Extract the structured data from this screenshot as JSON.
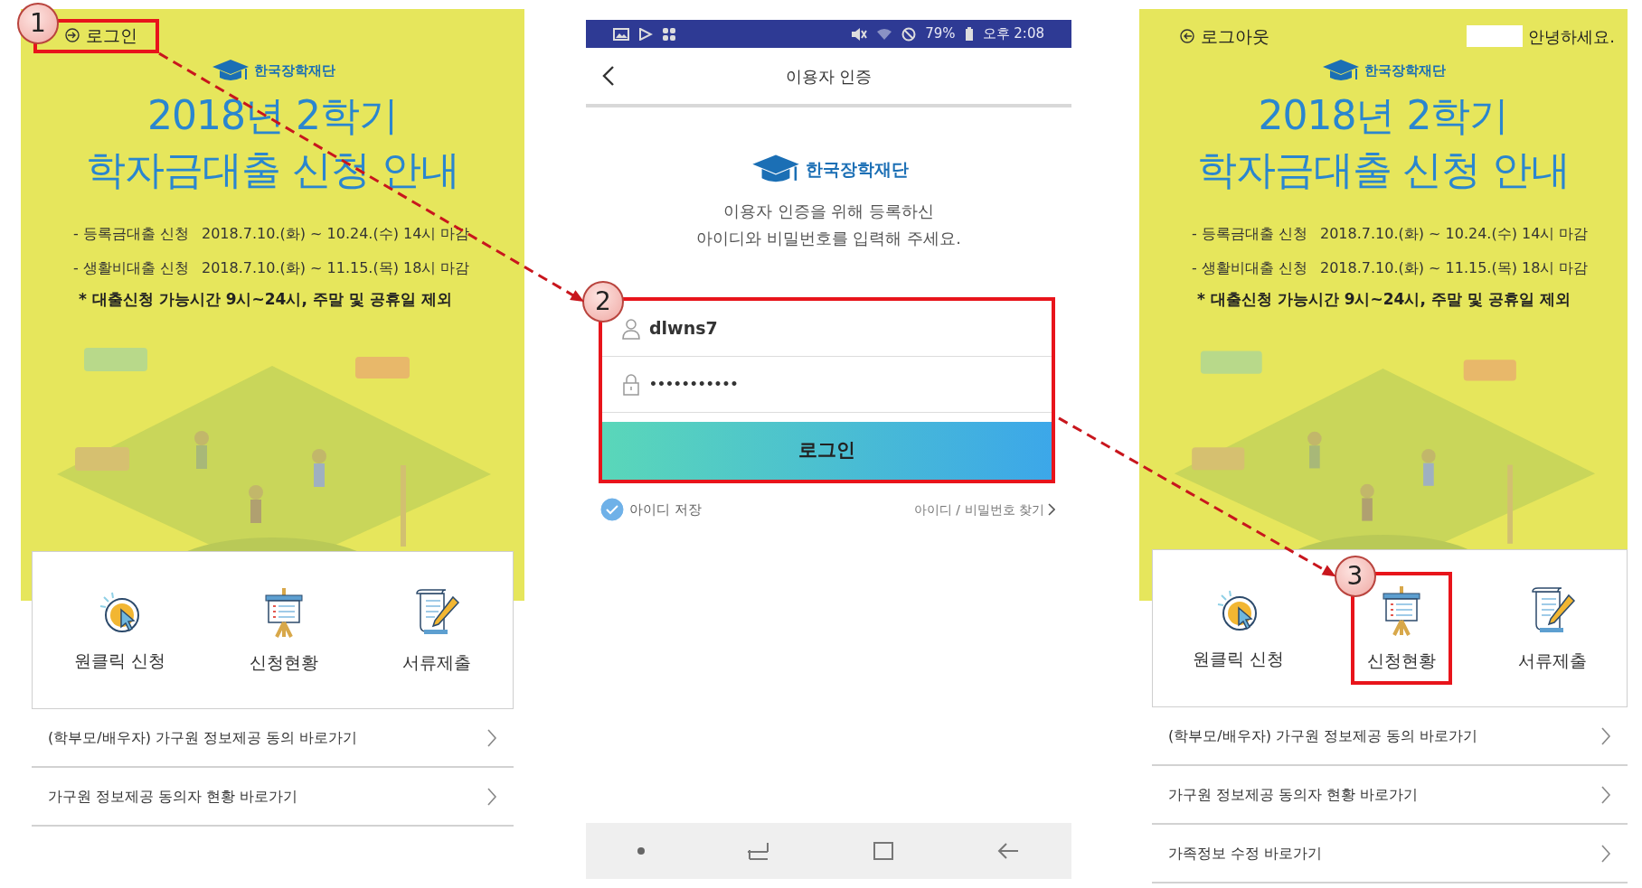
{
  "screens": [
    {
      "kind": "home",
      "account_link": {
        "kind": "login",
        "label": "로그인",
        "callout": "1"
      },
      "logo": "한국장학재단",
      "headline": [
        "2018년 2학기",
        "학자금대출 신청 안내"
      ],
      "schedule": [
        {
          "label": "- 등록금대출 신청",
          "period": "2018.7.10.(화) ~ 10.24.(수) 14시 마감"
        },
        {
          "label": "- 생활비대출 신청",
          "period": "2018.7.10.(화) ~ 11.15.(목) 18시 마감"
        }
      ],
      "note": "* 대출신청 가능시간 9시~24시, 주말 및 공휴일 제외",
      "menu": [
        {
          "kind": "click",
          "label": "원클릭 신청"
        },
        {
          "kind": "easel",
          "label": "신청현황"
        },
        {
          "kind": "scroll",
          "label": "서류제출"
        }
      ],
      "links": [
        {
          "label": "(학부모/배우자) 가구원 정보제공 동의 바로가기"
        },
        {
          "label": "가구원 정보제공 동의자 현황 바로가기"
        }
      ]
    },
    {
      "kind": "login",
      "status_bar": {
        "battery": "79%",
        "time": "오후 2:08"
      },
      "title": "이용자 인증",
      "logo": "한국장학재단",
      "instructions": [
        "이용자 인증을 위해 등록하신",
        "아이디와 비밀번호를 입력해 주세요."
      ],
      "form": {
        "callout": "2",
        "username": "dlwns7",
        "password": "•••••••••••",
        "submit": "로그인"
      },
      "remember_id": {
        "label": "아이디 저장",
        "checked": true
      },
      "find_link": "아이디 / 비밀번호 찾기"
    },
    {
      "kind": "home",
      "account_link": {
        "kind": "logout",
        "label": "로그아웃"
      },
      "greeting": {
        "name_redacted": true,
        "text": "안녕하세요."
      },
      "logo": "한국장학재단",
      "headline": [
        "2018년 2학기",
        "학자금대출 신청 안내"
      ],
      "schedule": [
        {
          "label": "- 등록금대출 신청",
          "period": "2018.7.10.(화) ~ 10.24.(수) 14시 마감"
        },
        {
          "label": "- 생활비대출 신청",
          "period": "2018.7.10.(화) ~ 11.15.(목) 18시 마감"
        }
      ],
      "note": "* 대출신청 가능시간 9시~24시, 주말 및 공휴일 제외",
      "menu": [
        {
          "kind": "click",
          "label": "원클릭 신청"
        },
        {
          "kind": "easel",
          "label": "신청현황",
          "callout": "3"
        },
        {
          "kind": "scroll",
          "label": "서류제출"
        }
      ],
      "links": [
        {
          "label": "(학부모/배우자) 가구원 정보제공 동의 바로가기"
        },
        {
          "label": "가구원 정보제공 동의자 현황 바로가기"
        },
        {
          "label": "가족정보 수정 바로가기"
        }
      ]
    }
  ]
}
